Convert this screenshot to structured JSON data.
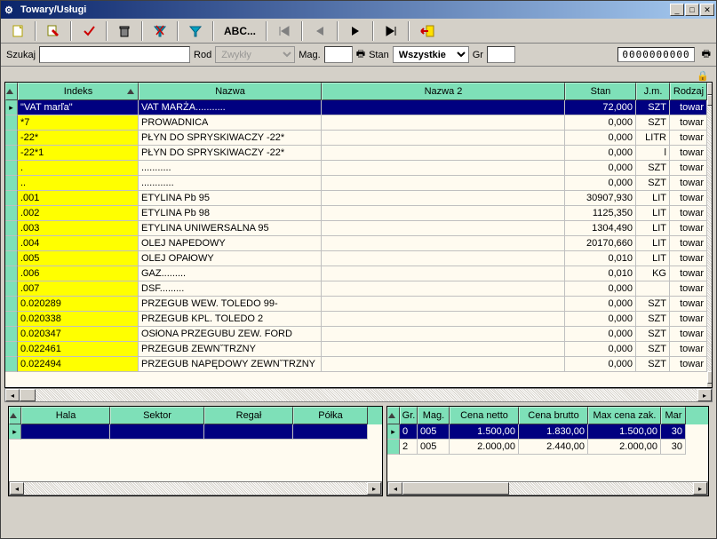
{
  "window": {
    "title": "Towary/Usługi"
  },
  "toolbar": {
    "abc": "ABC..."
  },
  "search": {
    "szukaj_label": "Szukaj",
    "szukaj_value": "",
    "rod_label": "Rod",
    "rod_value": "Zwykły",
    "mag_label": "Mag.",
    "mag_value": "",
    "stan_label": "Stan",
    "stan_value": "Wszystkie",
    "gr_label": "Gr",
    "gr_value": "",
    "counter": "0000000000"
  },
  "main_cols": {
    "sel": 14,
    "indeks": 136,
    "nazwa": 206,
    "nazwa2": 274,
    "stan": 80,
    "jm": 38,
    "rodzaj": 42
  },
  "main_headers": {
    "indeks": "Indeks",
    "nazwa": "Nazwa",
    "nazwa2": "Nazwa 2",
    "stan": "Stan",
    "jm": "J.m.",
    "rodzaj": "Rodzaj"
  },
  "rows": [
    {
      "indeks": "\"VAT marľa\"",
      "nazwa": "VAT MARŻA...........",
      "nazwa2": "",
      "stan": "72,000",
      "jm": "SZT",
      "rodzaj": "towar",
      "sel": true
    },
    {
      "indeks": "*7",
      "nazwa": "PROWADNICA",
      "nazwa2": "",
      "stan": "0,000",
      "jm": "SZT",
      "rodzaj": "towar"
    },
    {
      "indeks": "-22*",
      "nazwa": "PŁYN DO SPRYSKIWACZY -22*",
      "nazwa2": "",
      "stan": "0,000",
      "jm": "LITR",
      "rodzaj": "towar"
    },
    {
      "indeks": "-22*1",
      "nazwa": "PŁYN DO SPRYSKIWACZY -22*",
      "nazwa2": "",
      "stan": "0,000",
      "jm": "l",
      "rodzaj": "towar"
    },
    {
      "indeks": ".",
      "nazwa": "...........",
      "nazwa2": "",
      "stan": "0,000",
      "jm": "SZT",
      "rodzaj": "towar"
    },
    {
      "indeks": "..",
      "nazwa": "............",
      "nazwa2": "",
      "stan": "0,000",
      "jm": "SZT",
      "rodzaj": "towar"
    },
    {
      "indeks": ".001",
      "nazwa": "ETYLINA Pb 95",
      "nazwa2": "",
      "stan": "30907,930",
      "jm": "LIT",
      "rodzaj": "towar"
    },
    {
      "indeks": ".002",
      "nazwa": "ETYLINA Pb 98",
      "nazwa2": "",
      "stan": "1125,350",
      "jm": "LIT",
      "rodzaj": "towar"
    },
    {
      "indeks": ".003",
      "nazwa": "ETYLINA UNIWERSALNA 95",
      "nazwa2": "",
      "stan": "1304,490",
      "jm": "LIT",
      "rodzaj": "towar"
    },
    {
      "indeks": ".004",
      "nazwa": "OLEJ NAPEDOWY",
      "nazwa2": "",
      "stan": "20170,660",
      "jm": "LIT",
      "rodzaj": "towar"
    },
    {
      "indeks": ".005",
      "nazwa": "OLEJ OPAłOWY",
      "nazwa2": "",
      "stan": "0,010",
      "jm": "LIT",
      "rodzaj": "towar"
    },
    {
      "indeks": ".006",
      "nazwa": "GAZ.........",
      "nazwa2": "",
      "stan": "0,010",
      "jm": "KG",
      "rodzaj": "towar"
    },
    {
      "indeks": ".007",
      "nazwa": "DSF.........",
      "nazwa2": "",
      "stan": "0,000",
      "jm": "",
      "rodzaj": "towar"
    },
    {
      "indeks": "0.020289",
      "nazwa": "PRZEGUB WEW. TOLEDO 99-",
      "nazwa2": "",
      "stan": "0,000",
      "jm": "SZT",
      "rodzaj": "towar"
    },
    {
      "indeks": "0.020338",
      "nazwa": "PRZEGUB KPL. TOLEDO 2",
      "nazwa2": "",
      "stan": "0,000",
      "jm": "SZT",
      "rodzaj": "towar"
    },
    {
      "indeks": "0.020347",
      "nazwa": "OSłONA PRZEGUBU ZEW. FORD",
      "nazwa2": "",
      "stan": "0,000",
      "jm": "SZT",
      "rodzaj": "towar"
    },
    {
      "indeks": "0.022461",
      "nazwa": "PRZEGUB ZEWNˇTRZNY",
      "nazwa2": "",
      "stan": "0,000",
      "jm": "SZT",
      "rodzaj": "towar"
    },
    {
      "indeks": "0.022494",
      "nazwa": "PRZEGUB NAPĘDOWY ZEWNˇTRZNY",
      "nazwa2": "",
      "stan": "0,000",
      "jm": "SZT",
      "rodzaj": "towar"
    }
  ],
  "loc_headers": {
    "hala": "Hala",
    "sektor": "Sektor",
    "regal": "Regał",
    "polka": "Półka"
  },
  "loc_cols": {
    "sel": 14,
    "hala": 100,
    "sektor": 106,
    "regal": 100,
    "polka": 84
  },
  "loc_rows": [
    {
      "hala": "",
      "sektor": "",
      "regal": "",
      "polka": "",
      "sel": true
    }
  ],
  "price_headers": {
    "gr": "Gr.",
    "mag": "Mag.",
    "netto": "Cena netto",
    "brutto": "Cena brutto",
    "max": "Max cena zak.",
    "marz": "Mar"
  },
  "price_cols": {
    "sel": 14,
    "gr": 20,
    "mag": 36,
    "netto": 78,
    "brutto": 78,
    "max": 82,
    "marz": 28
  },
  "price_rows": [
    {
      "gr": "0",
      "mag": "005",
      "netto": "1.500,00",
      "brutto": "1.830,00",
      "max": "1.500,00",
      "marz": "30",
      "sel": true
    },
    {
      "gr": "2",
      "mag": "005",
      "netto": "2.000,00",
      "brutto": "2.440,00",
      "max": "2.000,00",
      "marz": "30"
    }
  ]
}
